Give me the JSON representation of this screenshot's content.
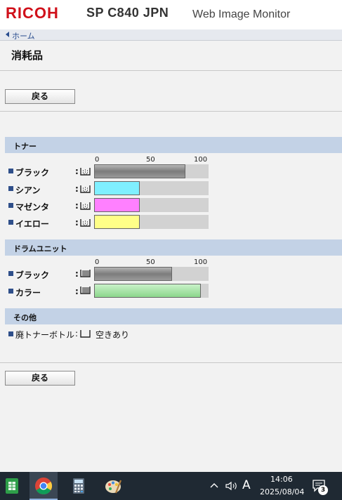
{
  "header": {
    "brand": "RICOH",
    "model": "SP C840 JPN",
    "product": "Web Image Monitor"
  },
  "breadcrumb": {
    "home_label": "ホーム"
  },
  "page": {
    "title": "消耗品",
    "back_label": "戻る"
  },
  "scale_labels": [
    "0",
    "50",
    "100"
  ],
  "toner": {
    "heading": "トナー",
    "items": [
      {
        "label": "ブラック",
        "level": 80,
        "color": "#8e8e8e"
      },
      {
        "label": "シアン",
        "level": 40,
        "color": "#7fefff"
      },
      {
        "label": "マゼンタ",
        "level": 40,
        "color": "#ff80ff"
      },
      {
        "label": "イエロー",
        "level": 40,
        "color": "#ffff88"
      }
    ]
  },
  "drum": {
    "heading": "ドラムユニット",
    "items": [
      {
        "label": "ブラック",
        "level": 68,
        "color": "#8e8e8e"
      },
      {
        "label": "カラー",
        "level": 93,
        "color": "#9be29b"
      }
    ]
  },
  "other": {
    "heading": "その他",
    "waste_label": "廃トナーボトル",
    "waste_status": "空きあり"
  },
  "taskbar": {
    "time": "14:06",
    "date": "2025/08/04",
    "ime": "A",
    "notification_count": "3",
    "apps": [
      "spreadsheet-icon",
      "chrome-icon",
      "calculator-icon",
      "paint-icon"
    ]
  }
}
